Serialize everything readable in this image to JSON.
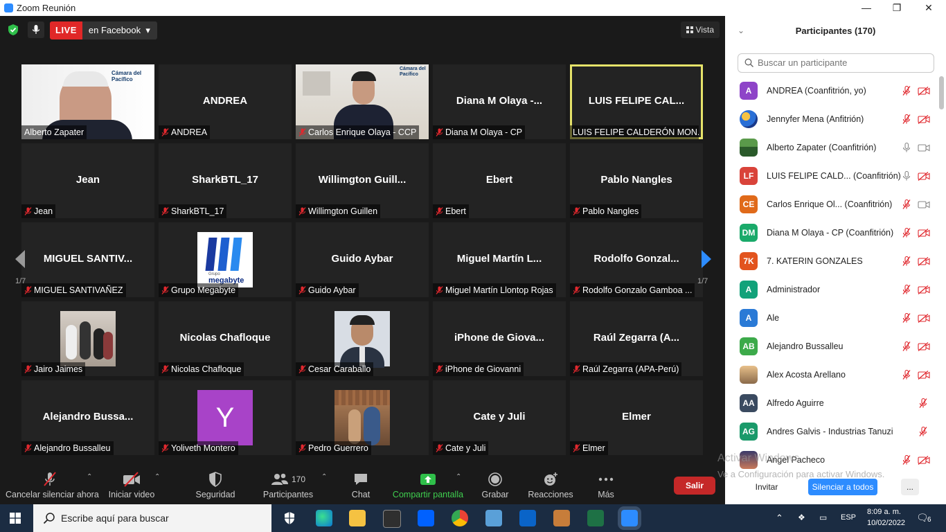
{
  "window": {
    "title": "Zoom Reunión",
    "minimize": "—",
    "maximize": "❐",
    "close": "✕"
  },
  "topbar": {
    "live": "LIVE",
    "destination": "en Facebook",
    "caret": "▾",
    "view": "Vista"
  },
  "grid": {
    "page_left": "1/7",
    "page_right": "1/7",
    "tiles": [
      {
        "big": "",
        "label": "Alberto Zapater",
        "muted": false,
        "photo": "photo-alberto"
      },
      {
        "big": "ANDREA",
        "label": "ANDREA",
        "muted": true
      },
      {
        "big": "",
        "label": "Carlos Enrique Olaya - CCP",
        "muted": true,
        "photo": "photo-carlos"
      },
      {
        "big": "Diana M Olaya -...",
        "label": "Diana M Olaya - CP",
        "muted": true
      },
      {
        "big": "LUIS FELIPE CAL...",
        "label": "LUIS FELIPE CALDERÓN MON...",
        "muted": false,
        "active": true
      },
      {
        "big": "Jean",
        "label": "Jean",
        "muted": true
      },
      {
        "big": "SharkBTL_17",
        "label": "SharkBTL_17",
        "muted": true
      },
      {
        "big": "Willimgton  Guill...",
        "label": "Willimgton Guillen",
        "muted": true
      },
      {
        "big": "Ebert",
        "label": "Ebert",
        "muted": true
      },
      {
        "big": "Pablo Nangles",
        "label": "Pablo Nangles",
        "muted": true
      },
      {
        "big": "MIGUEL SANTIV...",
        "label": "MIGUEL SANTIVAÑEZ",
        "muted": true
      },
      {
        "big": "",
        "label": "Grupo Megabyte",
        "muted": true,
        "photo": "logo-megabyte"
      },
      {
        "big": "Guido Aybar",
        "label": "Guido Aybar",
        "muted": true
      },
      {
        "big": "Miguel  Martín  L...",
        "label": "Miguel Martín Llontop Rojas",
        "muted": true
      },
      {
        "big": "Rodolfo  Gonzal...",
        "label": "Rodolfo Gonzalo Gamboa ...",
        "muted": true
      },
      {
        "big": "",
        "label": "Jairo Jaimes",
        "muted": true,
        "photo": "photo-jairo"
      },
      {
        "big": "Nicolas Chafloque",
        "label": "Nicolas Chafloque",
        "muted": true
      },
      {
        "big": "",
        "label": "Cesar Caraballo",
        "muted": true,
        "photo": "photo-cesar"
      },
      {
        "big": "iPhone  de  Giova...",
        "label": "iPhone de Giovanni",
        "muted": true
      },
      {
        "big": "Raúl  Zegarra  (A...",
        "label": "Raúl Zegarra (APA-Perú)",
        "muted": true
      },
      {
        "big": "Alejandro  Bussa...",
        "label": "Alejandro Bussalleu",
        "muted": true
      },
      {
        "big": "",
        "label": "Yoliveth Montero",
        "muted": true,
        "photo": "avatar-y"
      },
      {
        "big": "",
        "label": "Pedro Guerrero",
        "muted": true,
        "photo": "photo-pedro"
      },
      {
        "big": "Cate y Juli",
        "label": "Cate y Juli",
        "muted": true
      },
      {
        "big": "Elmer",
        "label": "Elmer",
        "muted": true
      }
    ],
    "logo_camara_line1": "Cámara del",
    "logo_camara_line2": "Pacífico",
    "megabyte_small": "Grupo",
    "megabyte_text": "megabyte",
    "avatar_y_letter": "Y"
  },
  "toolbar": {
    "mute": "Cancelar silenciar ahora",
    "video": "Iniciar video",
    "security": "Seguridad",
    "participants": "Participantes",
    "participants_count": "170",
    "chat": "Chat",
    "share": "Compartir pantalla",
    "record": "Grabar",
    "reactions": "Reacciones",
    "more": "Más",
    "leave": "Salir",
    "caret": "⌃"
  },
  "panel": {
    "title": "Participantes (170)",
    "collapse": "⌄",
    "search_placeholder": "Buscar un participante",
    "participants": [
      {
        "initials": "A",
        "color": "#8e44c8",
        "name": "ANDREA (Coanfitrión, yo)",
        "mic": "muted",
        "cam": "off"
      },
      {
        "initials": "",
        "color": "#2a6fd6",
        "name": "Jennyfer Mena (Anfitrión)",
        "mic": "muted",
        "cam": "off",
        "img": "globe"
      },
      {
        "initials": "",
        "color": "#4a8a3a",
        "name": "Alberto Zapater (Coanfitrión)",
        "mic": "on",
        "cam": "on",
        "img": "person"
      },
      {
        "initials": "LF",
        "color": "#d9433a",
        "name": "LUIS FELIPE CALD...  (Coanfitrión)",
        "mic": "on",
        "cam": "off"
      },
      {
        "initials": "CE",
        "color": "#e06a1a",
        "name": "Carlos Enrique Ol...  (Coanfitrión)",
        "mic": "muted",
        "cam": "on"
      },
      {
        "initials": "DM",
        "color": "#1aaa6a",
        "name": "Diana M Olaya - CP (Coanfitrión)",
        "mic": "muted",
        "cam": "off"
      },
      {
        "initials": "7K",
        "color": "#e2541e",
        "name": "7. KATERIN GONZALES",
        "mic": "muted",
        "cam": "off"
      },
      {
        "initials": "A",
        "color": "#12a27a",
        "name": "Administrador",
        "mic": "muted",
        "cam": "off"
      },
      {
        "initials": "A",
        "color": "#2a7ad6",
        "name": "Ale",
        "mic": "muted",
        "cam": "off"
      },
      {
        "initials": "AB",
        "color": "#3caa4a",
        "name": "Alejandro Bussalleu",
        "mic": "muted",
        "cam": "off"
      },
      {
        "initials": "",
        "color": "#c9a77a",
        "name": "Alex Acosta Arellano",
        "mic": "muted",
        "cam": "off",
        "img": "sunset"
      },
      {
        "initials": "AA",
        "color": "#3a4a60",
        "name": "Alfredo Aguirre",
        "mic": "muted",
        "cam": "none"
      },
      {
        "initials": "AG",
        "color": "#1a9a6a",
        "name": "Andres Galvis - Industrias Tanuzi",
        "mic": "muted",
        "cam": "none"
      },
      {
        "initials": "",
        "color": "#a04a3a",
        "name": "Angel Pacheco",
        "mic": "muted",
        "cam": "off",
        "img": "person2"
      }
    ],
    "invite": "Invitar",
    "mute_all": "Silenciar a todos",
    "more": "..."
  },
  "watermark": {
    "line1": "Activar Windows",
    "line2": "Ve a Configuración para activar Windows."
  },
  "taskbar": {
    "search_placeholder": "Escribe aquí para buscar",
    "lang": "ESP",
    "time": "8:09 a. m.",
    "date": "10/02/2022",
    "notifications": "6"
  }
}
